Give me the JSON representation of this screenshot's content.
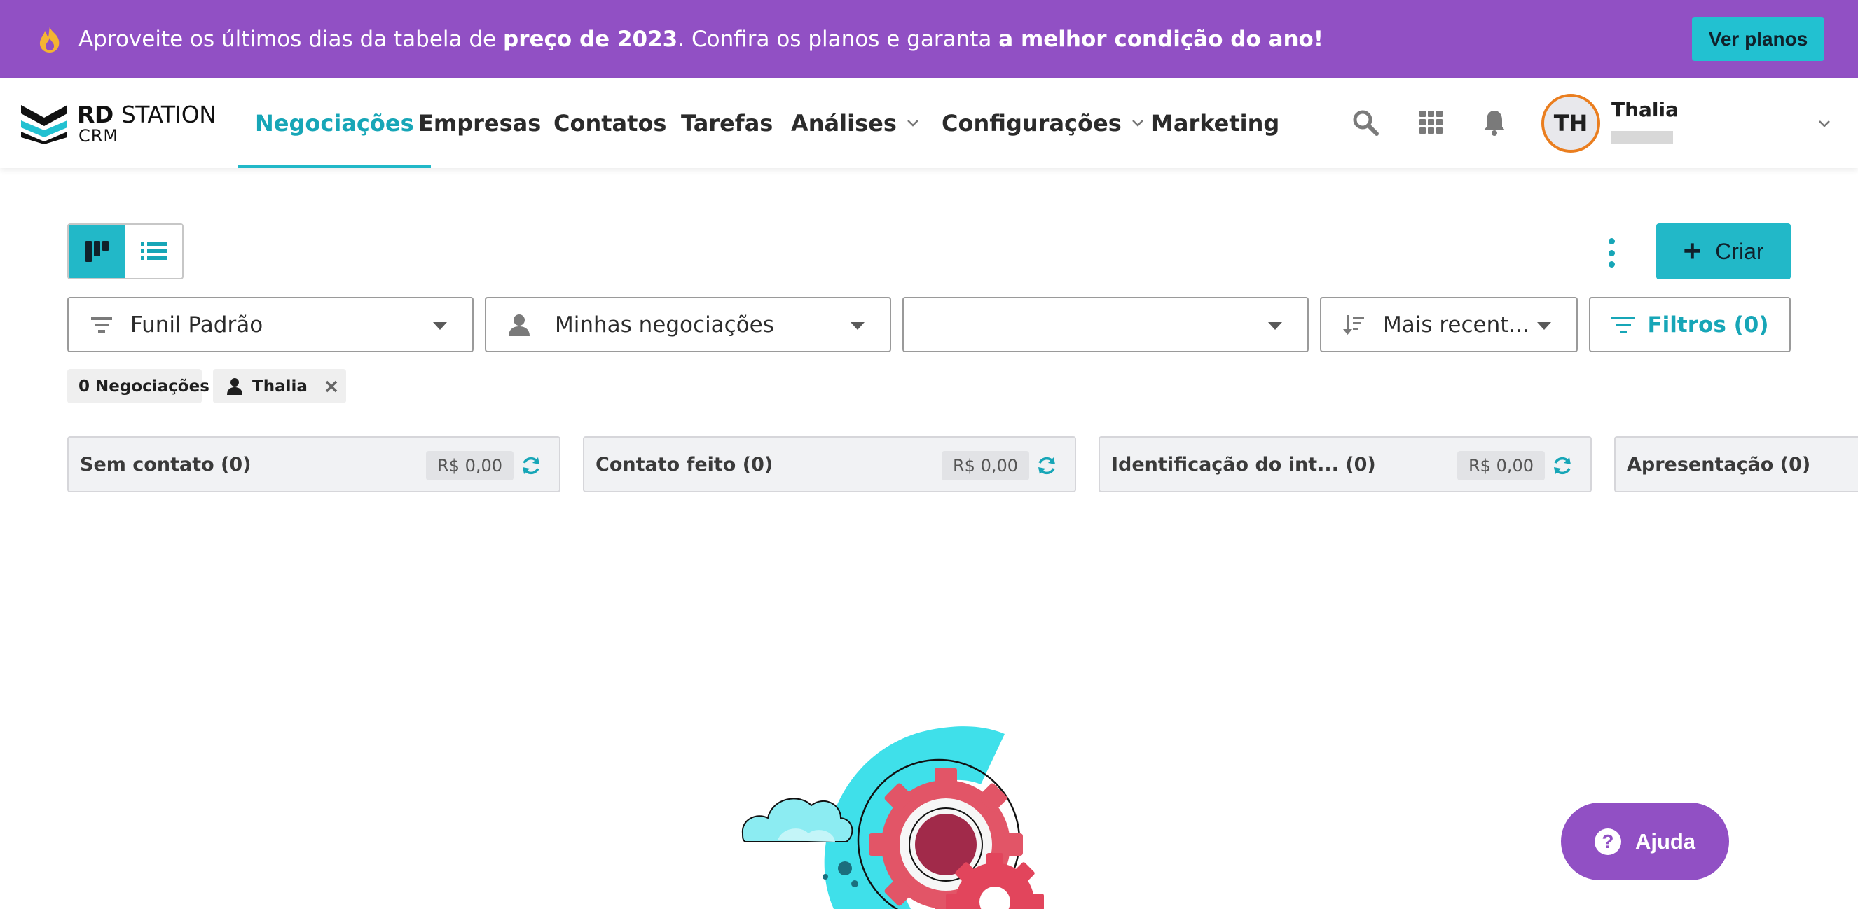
{
  "promo": {
    "text_1": "Aproveite os últimos dias da tabela de ",
    "bold_1": "preço de 2023",
    "text_2": ". Confira os planos e garanta ",
    "bold_2": "a melhor condição do ano!",
    "button": "Ver planos",
    "icon": "flame-icon"
  },
  "logo": {
    "brand_bold": "RD",
    "brand_light": "STATION",
    "sub": "CRM"
  },
  "nav": {
    "items": [
      {
        "label": "Negociações",
        "active": true
      },
      {
        "label": "Empresas"
      },
      {
        "label": "Contatos"
      },
      {
        "label": "Tarefas"
      },
      {
        "label": "Análises",
        "dropdown": true
      },
      {
        "label": "Configurações",
        "dropdown": true
      },
      {
        "label": "Marketing"
      }
    ],
    "icons": [
      "search-icon",
      "apps-grid-icon",
      "bell-icon"
    ]
  },
  "user": {
    "initials": "TH",
    "name": "Thalia"
  },
  "toolbar": {
    "create_label": "Criar"
  },
  "filters": {
    "funnel": "Funil Padrão",
    "owner": "Minhas negociações",
    "third": "",
    "sort": "Mais recent...",
    "filters_label": "Filtros (0)"
  },
  "chips": {
    "count": "0 Negociações",
    "user": "Thalia"
  },
  "columns": [
    {
      "title": "Sem contato (0)",
      "amount": "R$ 0,00"
    },
    {
      "title": "Contato feito (0)",
      "amount": "R$ 0,00"
    },
    {
      "title": "Identificação do int...  (0)",
      "amount": "R$ 0,00"
    },
    {
      "title": "Apresentação (0)"
    }
  ],
  "help": {
    "label": "Ajuda"
  },
  "colors": {
    "purple": "#9150c4",
    "teal": "#22b8c8",
    "orange": "#ea7e1f"
  }
}
